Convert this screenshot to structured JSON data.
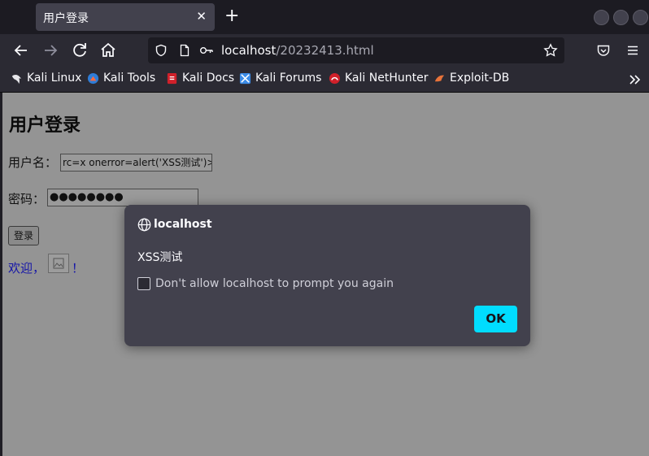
{
  "browser": {
    "tab": {
      "title": "用户登录",
      "close": "✕"
    },
    "new_tab": "+",
    "url": {
      "host": "localhost",
      "path": "/20232413.html"
    }
  },
  "bookmarks": [
    {
      "label": "Kali Linux",
      "icon": "kali-dragon-icon"
    },
    {
      "label": "Kali Tools",
      "icon": "kali-tools-icon"
    },
    {
      "label": "Kali Docs",
      "icon": "kali-docs-icon"
    },
    {
      "label": "Kali Forums",
      "icon": "kali-forums-icon"
    },
    {
      "label": "Kali NetHunter",
      "icon": "nethunter-icon"
    },
    {
      "label": "Exploit-DB",
      "icon": "exploit-db-icon"
    }
  ],
  "page": {
    "heading": "用户登录",
    "username_label": "用户名：",
    "username_value": "rc=x onerror=alert('XSS测试')>",
    "password_label": "密码：",
    "password_value": "●●●●●●●●",
    "login_button": "登录",
    "welcome_text": "欢迎，",
    "welcome_suffix": "！"
  },
  "dialog": {
    "origin": "localhost",
    "message": "XSS测试",
    "checkbox_label": "Don't allow localhost to prompt you again",
    "ok_button": "OK"
  },
  "colors": {
    "accent": "#00ddff",
    "dialog_bg": "#42414d",
    "page_overlay": "#949494"
  }
}
